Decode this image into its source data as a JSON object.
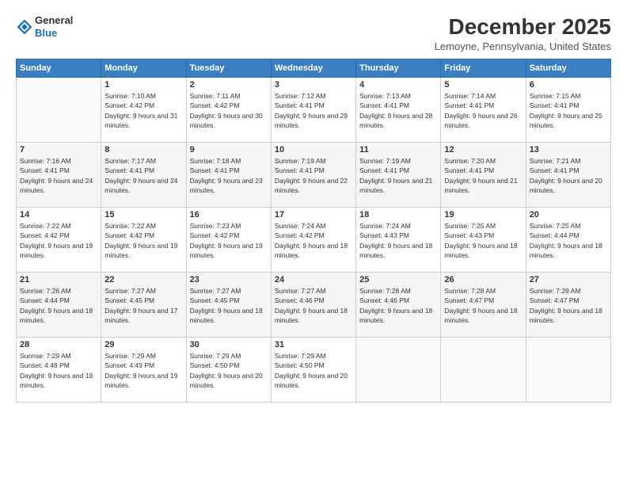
{
  "header": {
    "logo_general": "General",
    "logo_blue": "Blue",
    "month_title": "December 2025",
    "location": "Lemoyne, Pennsylvania, United States"
  },
  "days_header": [
    "Sunday",
    "Monday",
    "Tuesday",
    "Wednesday",
    "Thursday",
    "Friday",
    "Saturday"
  ],
  "weeks": [
    [
      {
        "date": "",
        "sunrise": "",
        "sunset": "",
        "daylight": ""
      },
      {
        "date": "1",
        "sunrise": "Sunrise: 7:10 AM",
        "sunset": "Sunset: 4:42 PM",
        "daylight": "Daylight: 9 hours and 31 minutes."
      },
      {
        "date": "2",
        "sunrise": "Sunrise: 7:11 AM",
        "sunset": "Sunset: 4:42 PM",
        "daylight": "Daylight: 9 hours and 30 minutes."
      },
      {
        "date": "3",
        "sunrise": "Sunrise: 7:12 AM",
        "sunset": "Sunset: 4:41 PM",
        "daylight": "Daylight: 9 hours and 29 minutes."
      },
      {
        "date": "4",
        "sunrise": "Sunrise: 7:13 AM",
        "sunset": "Sunset: 4:41 PM",
        "daylight": "Daylight: 9 hours and 28 minutes."
      },
      {
        "date": "5",
        "sunrise": "Sunrise: 7:14 AM",
        "sunset": "Sunset: 4:41 PM",
        "daylight": "Daylight: 9 hours and 26 minutes."
      },
      {
        "date": "6",
        "sunrise": "Sunrise: 7:15 AM",
        "sunset": "Sunset: 4:41 PM",
        "daylight": "Daylight: 9 hours and 25 minutes."
      }
    ],
    [
      {
        "date": "7",
        "sunrise": "Sunrise: 7:16 AM",
        "sunset": "Sunset: 4:41 PM",
        "daylight": "Daylight: 9 hours and 24 minutes."
      },
      {
        "date": "8",
        "sunrise": "Sunrise: 7:17 AM",
        "sunset": "Sunset: 4:41 PM",
        "daylight": "Daylight: 9 hours and 24 minutes."
      },
      {
        "date": "9",
        "sunrise": "Sunrise: 7:18 AM",
        "sunset": "Sunset: 4:41 PM",
        "daylight": "Daylight: 9 hours and 23 minutes."
      },
      {
        "date": "10",
        "sunrise": "Sunrise: 7:19 AM",
        "sunset": "Sunset: 4:41 PM",
        "daylight": "Daylight: 9 hours and 22 minutes."
      },
      {
        "date": "11",
        "sunrise": "Sunrise: 7:19 AM",
        "sunset": "Sunset: 4:41 PM",
        "daylight": "Daylight: 9 hours and 21 minutes."
      },
      {
        "date": "12",
        "sunrise": "Sunrise: 7:20 AM",
        "sunset": "Sunset: 4:41 PM",
        "daylight": "Daylight: 9 hours and 21 minutes."
      },
      {
        "date": "13",
        "sunrise": "Sunrise: 7:21 AM",
        "sunset": "Sunset: 4:41 PM",
        "daylight": "Daylight: 9 hours and 20 minutes."
      }
    ],
    [
      {
        "date": "14",
        "sunrise": "Sunrise: 7:22 AM",
        "sunset": "Sunset: 4:42 PM",
        "daylight": "Daylight: 9 hours and 19 minutes."
      },
      {
        "date": "15",
        "sunrise": "Sunrise: 7:22 AM",
        "sunset": "Sunset: 4:42 PM",
        "daylight": "Daylight: 9 hours and 19 minutes."
      },
      {
        "date": "16",
        "sunrise": "Sunrise: 7:23 AM",
        "sunset": "Sunset: 4:42 PM",
        "daylight": "Daylight: 9 hours and 19 minutes."
      },
      {
        "date": "17",
        "sunrise": "Sunrise: 7:24 AM",
        "sunset": "Sunset: 4:42 PM",
        "daylight": "Daylight: 9 hours and 18 minutes."
      },
      {
        "date": "18",
        "sunrise": "Sunrise: 7:24 AM",
        "sunset": "Sunset: 4:43 PM",
        "daylight": "Daylight: 9 hours and 18 minutes."
      },
      {
        "date": "19",
        "sunrise": "Sunrise: 7:25 AM",
        "sunset": "Sunset: 4:43 PM",
        "daylight": "Daylight: 9 hours and 18 minutes."
      },
      {
        "date": "20",
        "sunrise": "Sunrise: 7:25 AM",
        "sunset": "Sunset: 4:44 PM",
        "daylight": "Daylight: 9 hours and 18 minutes."
      }
    ],
    [
      {
        "date": "21",
        "sunrise": "Sunrise: 7:26 AM",
        "sunset": "Sunset: 4:44 PM",
        "daylight": "Daylight: 9 hours and 18 minutes."
      },
      {
        "date": "22",
        "sunrise": "Sunrise: 7:27 AM",
        "sunset": "Sunset: 4:45 PM",
        "daylight": "Daylight: 9 hours and 17 minutes."
      },
      {
        "date": "23",
        "sunrise": "Sunrise: 7:27 AM",
        "sunset": "Sunset: 4:45 PM",
        "daylight": "Daylight: 9 hours and 18 minutes."
      },
      {
        "date": "24",
        "sunrise": "Sunrise: 7:27 AM",
        "sunset": "Sunset: 4:46 PM",
        "daylight": "Daylight: 9 hours and 18 minutes."
      },
      {
        "date": "25",
        "sunrise": "Sunrise: 7:28 AM",
        "sunset": "Sunset: 4:46 PM",
        "daylight": "Daylight: 9 hours and 18 minutes."
      },
      {
        "date": "26",
        "sunrise": "Sunrise: 7:28 AM",
        "sunset": "Sunset: 4:47 PM",
        "daylight": "Daylight: 9 hours and 18 minutes."
      },
      {
        "date": "27",
        "sunrise": "Sunrise: 7:29 AM",
        "sunset": "Sunset: 4:47 PM",
        "daylight": "Daylight: 9 hours and 18 minutes."
      }
    ],
    [
      {
        "date": "28",
        "sunrise": "Sunrise: 7:29 AM",
        "sunset": "Sunset: 4:48 PM",
        "daylight": "Daylight: 9 hours and 19 minutes."
      },
      {
        "date": "29",
        "sunrise": "Sunrise: 7:29 AM",
        "sunset": "Sunset: 4:49 PM",
        "daylight": "Daylight: 9 hours and 19 minutes."
      },
      {
        "date": "30",
        "sunrise": "Sunrise: 7:29 AM",
        "sunset": "Sunset: 4:50 PM",
        "daylight": "Daylight: 9 hours and 20 minutes."
      },
      {
        "date": "31",
        "sunrise": "Sunrise: 7:29 AM",
        "sunset": "Sunset: 4:50 PM",
        "daylight": "Daylight: 9 hours and 20 minutes."
      },
      {
        "date": "",
        "sunrise": "",
        "sunset": "",
        "daylight": ""
      },
      {
        "date": "",
        "sunrise": "",
        "sunset": "",
        "daylight": ""
      },
      {
        "date": "",
        "sunrise": "",
        "sunset": "",
        "daylight": ""
      }
    ]
  ]
}
